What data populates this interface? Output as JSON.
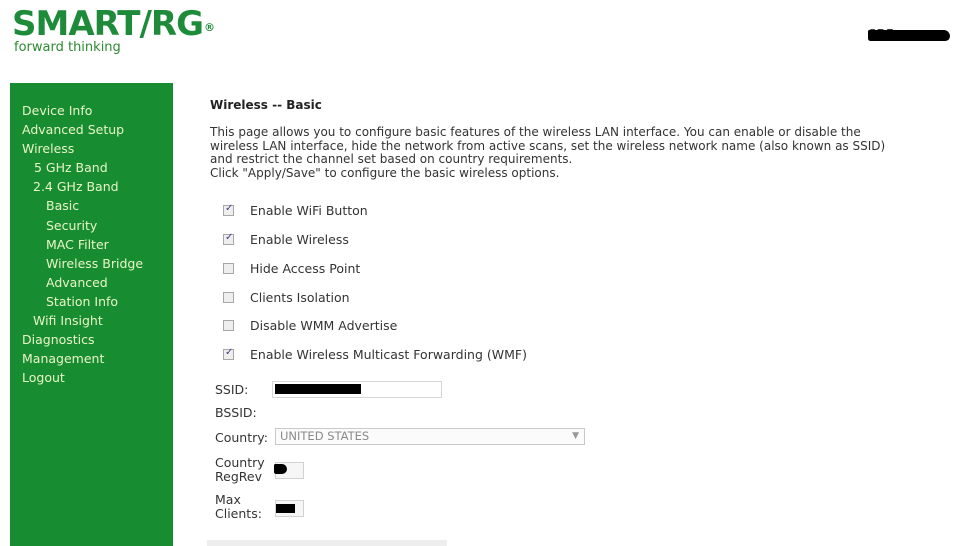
{
  "header": {
    "brand": "SMART/RG",
    "brand_mark": "®",
    "tagline": "forward thinking",
    "model_label": "SR5"
  },
  "sidebar": {
    "items": [
      {
        "label": "Device Info",
        "level": 0
      },
      {
        "label": "Advanced Setup",
        "level": 0
      },
      {
        "label": "Wireless",
        "level": 0
      },
      {
        "label": "5 GHz Band",
        "level": 1
      },
      {
        "label": "2.4 GHz Band",
        "level": 1
      },
      {
        "label": "Basic",
        "level": 2
      },
      {
        "label": "Security",
        "level": 2
      },
      {
        "label": "MAC Filter",
        "level": 2
      },
      {
        "label": "Wireless Bridge",
        "level": 2
      },
      {
        "label": "Advanced",
        "level": 2
      },
      {
        "label": "Station Info",
        "level": 2
      },
      {
        "label": "Wifi Insight",
        "level": 1
      },
      {
        "label": "Diagnostics",
        "level": 0
      },
      {
        "label": "Management",
        "level": 0
      },
      {
        "label": "Logout",
        "level": 0
      }
    ]
  },
  "main": {
    "title": "Wireless -- Basic",
    "description_lines": [
      "This page allows you to configure basic features of the wireless LAN interface. You can enable or disable the",
      "wireless LAN interface, hide the network from active scans, set the wireless network name (also known as SSID)",
      "and restrict the channel set based on country requirements.",
      "Click \"Apply/Save\" to configure the basic wireless options."
    ],
    "checkboxes": [
      {
        "label": "Enable WiFi Button",
        "checked": true
      },
      {
        "label": "Enable Wireless",
        "checked": true
      },
      {
        "label": "Hide Access Point",
        "checked": false
      },
      {
        "label": "Clients Isolation",
        "checked": false
      },
      {
        "label": "Disable WMM Advertise",
        "checked": false
      },
      {
        "label": "Enable Wireless Multicast Forwarding (WMF)",
        "checked": true
      }
    ],
    "fields": {
      "ssid_label": "SSID:",
      "ssid_value": "",
      "bssid_label": "BSSID:",
      "bssid_value": "",
      "country_label": "Country:",
      "country_value": "UNITED STATES",
      "regrev_label_1": "Country",
      "regrev_label_2": "RegRev",
      "regrev_value": "",
      "maxclients_label_1": "Max",
      "maxclients_label_2": "Clients:",
      "maxclients_value": ""
    }
  },
  "colors": {
    "sidebar_bg": "#188c31",
    "sidebar_text": "#e8f6c8",
    "brand_green": "#1e8b3a"
  }
}
